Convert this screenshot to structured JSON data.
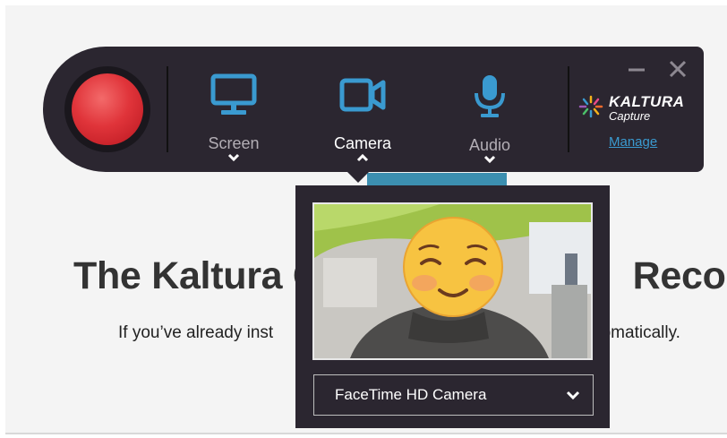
{
  "page": {
    "title": "The Kaltura C",
    "title_right": "Record",
    "subtitle": "If you’ve already inst",
    "subtitle_right": "automatically."
  },
  "toolbar": {
    "items": [
      {
        "label": "Screen",
        "icon": "monitor-icon",
        "state": "collapsed"
      },
      {
        "label": "Camera",
        "icon": "video-camera-icon",
        "state": "expanded"
      },
      {
        "label": "Audio",
        "icon": "microphone-icon",
        "state": "collapsed"
      }
    ],
    "logo_text": "KALTURA",
    "logo_sub": "Capture",
    "manage_label": "Manage"
  },
  "camera_popup": {
    "selected_camera": "FaceTime HD Camera"
  },
  "colors": {
    "toolbar_bg": "#2b2630",
    "record_red": "#e0343a",
    "icon_blue": "#3a9ad0",
    "link_blue": "#3a9ad0"
  }
}
